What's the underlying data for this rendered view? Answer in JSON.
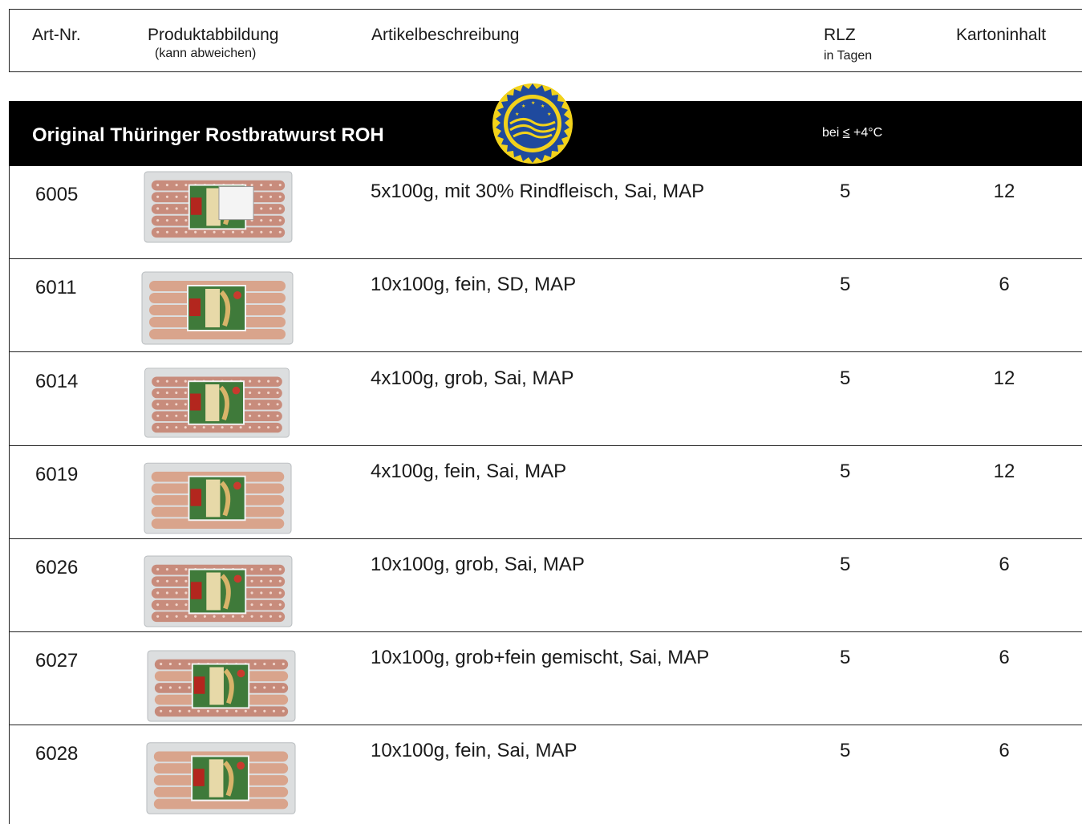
{
  "header": {
    "art_nr": "Art-Nr.",
    "produktabbildung": "Produktabbildung",
    "produktabbildung_note": "(kann abweichen)",
    "artikelbeschreibung": "Artikelbeschreibung",
    "rlz": "RLZ",
    "rlz_note": "in Tagen",
    "kartoninhalt": "Kartoninhalt"
  },
  "section": {
    "title": "Original Thüringer Rostbratwurst ROH",
    "condition_prefix": "bei ",
    "condition_symbol": "≤",
    "condition_value": " +4°C",
    "seal_icon": "protected-geographical-indication-seal"
  },
  "rows": [
    {
      "art": "6005",
      "desc": "5x100g, mit 30% Rindfleisch, Sai, MAP",
      "rlz": "5",
      "qty": "12",
      "image": "sausage-pack-coarse-label"
    },
    {
      "art": "6011",
      "desc": "10x100g, fein, SD, MAP",
      "rlz": "5",
      "qty": "6",
      "image": "sausage-pack-fine"
    },
    {
      "art": "6014",
      "desc": "4x100g, grob, Sai, MAP",
      "rlz": "5",
      "qty": "12",
      "image": "sausage-pack-coarse"
    },
    {
      "art": "6019",
      "desc": "4x100g, fein, Sai, MAP",
      "rlz": "5",
      "qty": "12",
      "image": "sausage-pack-fine"
    },
    {
      "art": "6026",
      "desc": "10x100g, grob, Sai, MAP",
      "rlz": "5",
      "qty": "6",
      "image": "sausage-pack-coarse"
    },
    {
      "art": "6027",
      "desc": "10x100g, grob+fein gemischt, Sai, MAP",
      "rlz": "5",
      "qty": "6",
      "image": "sausage-pack-mixed"
    },
    {
      "art": "6028",
      "desc": "10x100g, fein, Sai, MAP",
      "rlz": "5",
      "qty": "6",
      "image": "sausage-pack-fine"
    }
  ],
  "colors": {
    "band": "#000000",
    "text": "#1a1a1a",
    "seal_blue": "#1f4a9e",
    "seal_yellow": "#f2d21b"
  }
}
